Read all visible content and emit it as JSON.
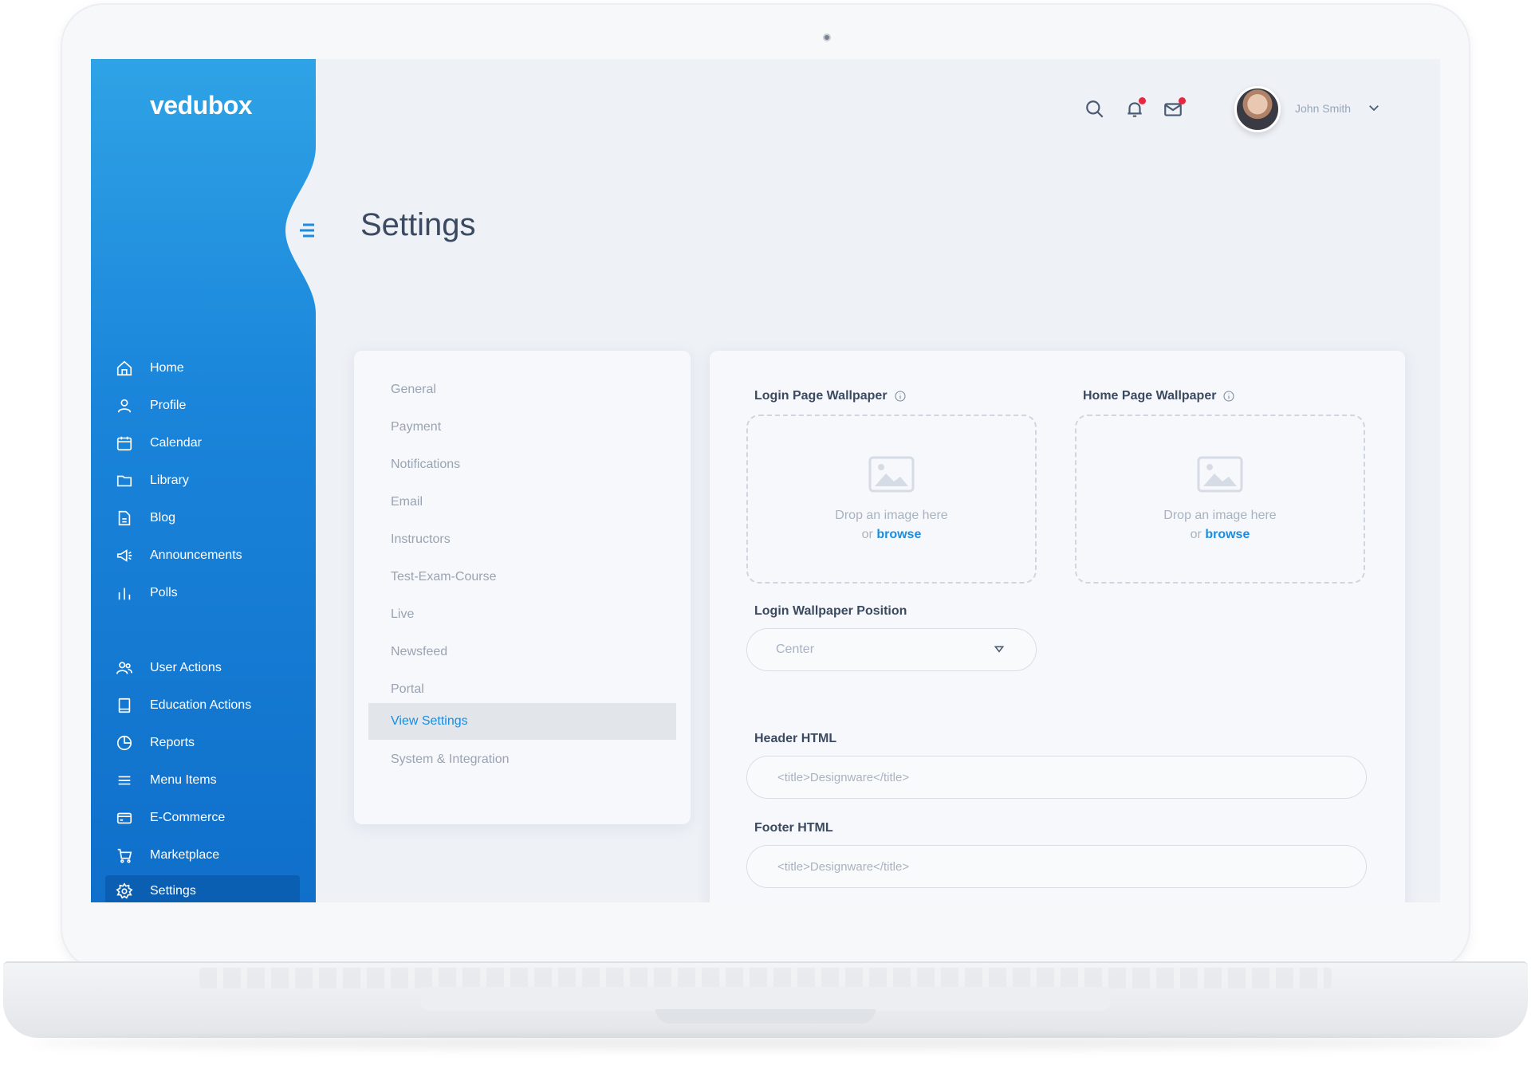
{
  "app": {
    "logo": "vedubox"
  },
  "sidebar": {
    "items": [
      {
        "label": "Home",
        "icon": "home-icon"
      },
      {
        "label": "Profile",
        "icon": "user-icon"
      },
      {
        "label": "Calendar",
        "icon": "calendar-icon"
      },
      {
        "label": "Library",
        "icon": "folder-icon"
      },
      {
        "label": "Blog",
        "icon": "document-icon"
      },
      {
        "label": "Announcements",
        "icon": "megaphone-icon"
      },
      {
        "label": "Polls",
        "icon": "bar-chart-icon"
      },
      {
        "label": "User Actions",
        "icon": "users-icon"
      },
      {
        "label": "Education Actions",
        "icon": "book-icon"
      },
      {
        "label": "Reports",
        "icon": "pie-chart-icon"
      },
      {
        "label": "Menu Items",
        "icon": "list-icon"
      },
      {
        "label": "E-Commerce",
        "icon": "credit-card-icon"
      },
      {
        "label": "Marketplace",
        "icon": "cart-icon"
      },
      {
        "label": "Settings",
        "icon": "gear-icon"
      }
    ],
    "active": "Settings"
  },
  "header": {
    "username": "John Smith",
    "icons": [
      "search-icon",
      "bell-icon",
      "mail-icon"
    ],
    "notification_color": "#e8263d"
  },
  "page": {
    "title": "Settings"
  },
  "settings_nav": {
    "items": [
      "General",
      "Payment",
      "Notifications",
      "Email",
      "Instructors",
      "Test-Exam-Course",
      "Live",
      "Newsfeed",
      "Portal",
      "View Settings",
      "System & Integration"
    ],
    "active": "View Settings"
  },
  "form": {
    "login_wallpaper": {
      "label": "Login Page Wallpaper",
      "drop_text": "Drop an image here",
      "or_text": "or",
      "browse_text": "browse"
    },
    "home_wallpaper": {
      "label": "Home Page Wallpaper",
      "drop_text": "Drop an image here",
      "or_text": "or",
      "browse_text": "browse"
    },
    "position": {
      "label": "Login Wallpaper Position",
      "value": "Center"
    },
    "header_html": {
      "label": "Header HTML",
      "placeholder": "<title>Designware</title>"
    },
    "footer_html": {
      "label": "Footer HTML",
      "placeholder": "<title>Designware</title>"
    }
  },
  "colors": {
    "sidebar_top": "#2fa3e6",
    "sidebar_bottom": "#0f6fca",
    "accent": "#1a8de0",
    "title": "#3b4a60"
  }
}
